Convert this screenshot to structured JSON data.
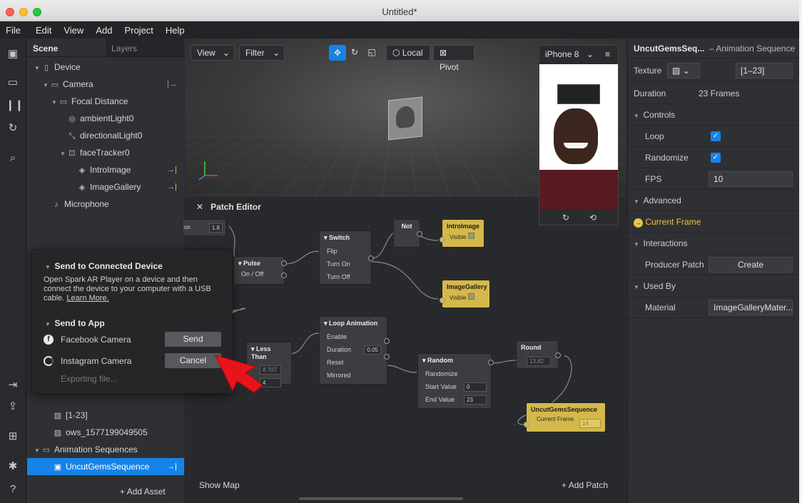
{
  "window": {
    "title": "Untitled*"
  },
  "menu": [
    "File",
    "Edit",
    "View",
    "Add",
    "Project",
    "Help"
  ],
  "scene_panel": {
    "tabs": [
      "Scene",
      "Layers"
    ],
    "tree": [
      {
        "label": "Device",
        "icon": "device-icon"
      },
      {
        "label": "Camera",
        "icon": "camera-icon"
      },
      {
        "label": "Focal Distance",
        "icon": "focal-icon"
      },
      {
        "label": "ambientLight0",
        "icon": "ambient-light-icon"
      },
      {
        "label": "directionalLight0",
        "icon": "directional-light-icon"
      },
      {
        "label": "faceTracker0",
        "icon": "face-tracker-icon"
      },
      {
        "label": "IntroImage",
        "icon": "plane-icon"
      },
      {
        "label": "ImageGallery",
        "icon": "plane-icon"
      },
      {
        "label": "Microphone",
        "icon": "microphone-icon"
      }
    ],
    "assets": [
      {
        "label": "[1-23]"
      },
      {
        "label": "ows_1577199049505"
      },
      {
        "label": "Animation Sequences"
      },
      {
        "label": "UncutGemsSequence"
      }
    ],
    "add_asset": "Add Asset"
  },
  "viewport": {
    "view": "View",
    "filter": "Filter",
    "local": "Local",
    "pivot": "Pivot",
    "device": "iPhone 8"
  },
  "patch_editor": {
    "title": "Patch Editor",
    "show_map": "Show Map",
    "add_patch": "Add Patch",
    "nodes": {
      "top_left_value": "1.8",
      "top_left_label": "on",
      "pulse": {
        "title": "Pulse",
        "port": "On / Off"
      },
      "switch": {
        "title": "Switch",
        "ports": [
          "Flip",
          "Turn On",
          "Turn Off"
        ]
      },
      "not": {
        "title": "Not"
      },
      "intro": {
        "title": "IntroImage",
        "port": "Visible"
      },
      "gallery": {
        "title": "ImageGallery",
        "port": "Visible"
      },
      "loop": {
        "title": "Loop Animation",
        "ports": [
          "Enable",
          "Duration",
          "Reset",
          "Mirrored"
        ],
        "duration": "0.05"
      },
      "lessthan": {
        "title": "Less Than",
        "a": "8.707",
        "b": "4"
      },
      "random": {
        "title": "Random",
        "ports": [
          "Randomize",
          "Start Value",
          "End Value"
        ],
        "start": "0",
        "end": "23"
      },
      "round": {
        "title": "Round",
        "value": "13.82"
      },
      "uncut": {
        "title": "UncutGemsSequence",
        "port": "Current Frame",
        "value": "14"
      }
    }
  },
  "popup": {
    "title": "Send to Connected Device",
    "desc": "Open Spark AR Player on a device and then connect the device to your computer with a USB cable.",
    "learn": "Learn More.",
    "send_title": "Send to App",
    "facebook": "Facebook Camera",
    "instagram": "Instagram Camera",
    "send_btn": "Send",
    "cancel_btn": "Cancel",
    "exporting": "Exporting file..."
  },
  "inspector": {
    "name": "UncutGemsSeq...",
    "type": "– Animation Sequence",
    "texture_label": "Texture",
    "texture_value": "[1–23]",
    "duration_label": "Duration",
    "duration_value": "23 Frames",
    "controls": "Controls",
    "loop": "Loop",
    "randomize": "Randomize",
    "fps_label": "FPS",
    "fps_value": "10",
    "advanced": "Advanced",
    "current_frame": "Current Frame",
    "interactions": "Interactions",
    "producer_patch": "Producer Patch",
    "create": "Create",
    "used_by": "Used By",
    "material_label": "Material",
    "material_value": "ImageGalleryMater..."
  },
  "colors": {
    "accent": "#1683e8",
    "patch_yellow": "#d5b84c",
    "arrow_red": "#e8141b"
  }
}
